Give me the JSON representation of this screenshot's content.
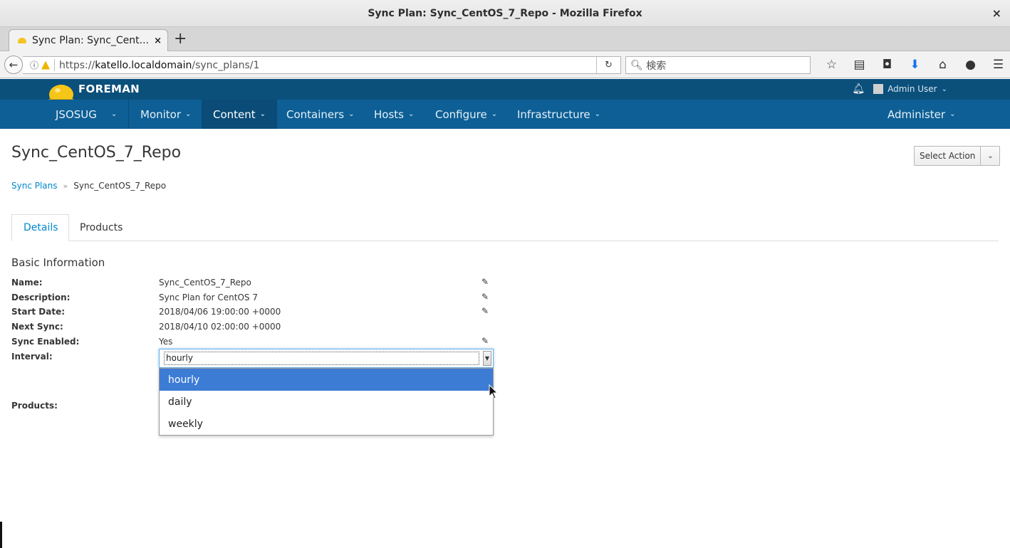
{
  "window": {
    "title": "Sync Plan: Sync_CentOS_7_Repo - Mozilla Firefox",
    "close_glyph": "×"
  },
  "browser": {
    "tab_label": "Sync Plan: Sync_Cent...",
    "tab_close": "×",
    "new_tab": "+",
    "url_host": "katello.localdomain",
    "url_prefix": "https://",
    "url_path": "/sync_plans/1",
    "search_placeholder": "検索",
    "back_glyph": "←",
    "reload_glyph": "↻"
  },
  "foreman": {
    "brand": "FOREMAN",
    "user": "Admin User",
    "nav": [
      {
        "label": "JSOSUG"
      },
      {
        "label": "Monitor"
      },
      {
        "label": "Content"
      },
      {
        "label": "Containers"
      },
      {
        "label": "Hosts"
      },
      {
        "label": "Configure"
      },
      {
        "label": "Infrastructure"
      },
      {
        "label": "Administer"
      }
    ]
  },
  "page": {
    "title": "Sync_CentOS_7_Repo",
    "select_action": "Select Action",
    "breadcrumb": {
      "parent": "Sync Plans",
      "current": "Sync_CentOS_7_Repo"
    },
    "tabs": [
      "Details",
      "Products"
    ],
    "section_title": "Basic Information",
    "fields": [
      {
        "label": "Name:",
        "value": "Sync_CentOS_7_Repo"
      },
      {
        "label": "Description:",
        "value": "Sync Plan for CentOS 7"
      },
      {
        "label": "Start Date:",
        "value": "2018/04/06 19:00:00 +0000"
      },
      {
        "label": "Next Sync:",
        "value": "2018/04/10 02:00:00 +0000"
      },
      {
        "label": "Sync Enabled:",
        "value": "Yes"
      },
      {
        "label": "Interval:",
        "value": ""
      },
      {
        "label": "Products:",
        "value": ""
      }
    ],
    "interval": {
      "selected": "hourly",
      "options": [
        "hourly",
        "daily",
        "weekly"
      ]
    }
  },
  "icons": {
    "edit": "pencil-square-icon",
    "bell": "bell-icon"
  },
  "colors": {
    "foreman_top": "#0b4f7b",
    "foreman_nav": "#0d5f95",
    "link": "#0088ce",
    "selected_option": "#3d7cd4"
  }
}
